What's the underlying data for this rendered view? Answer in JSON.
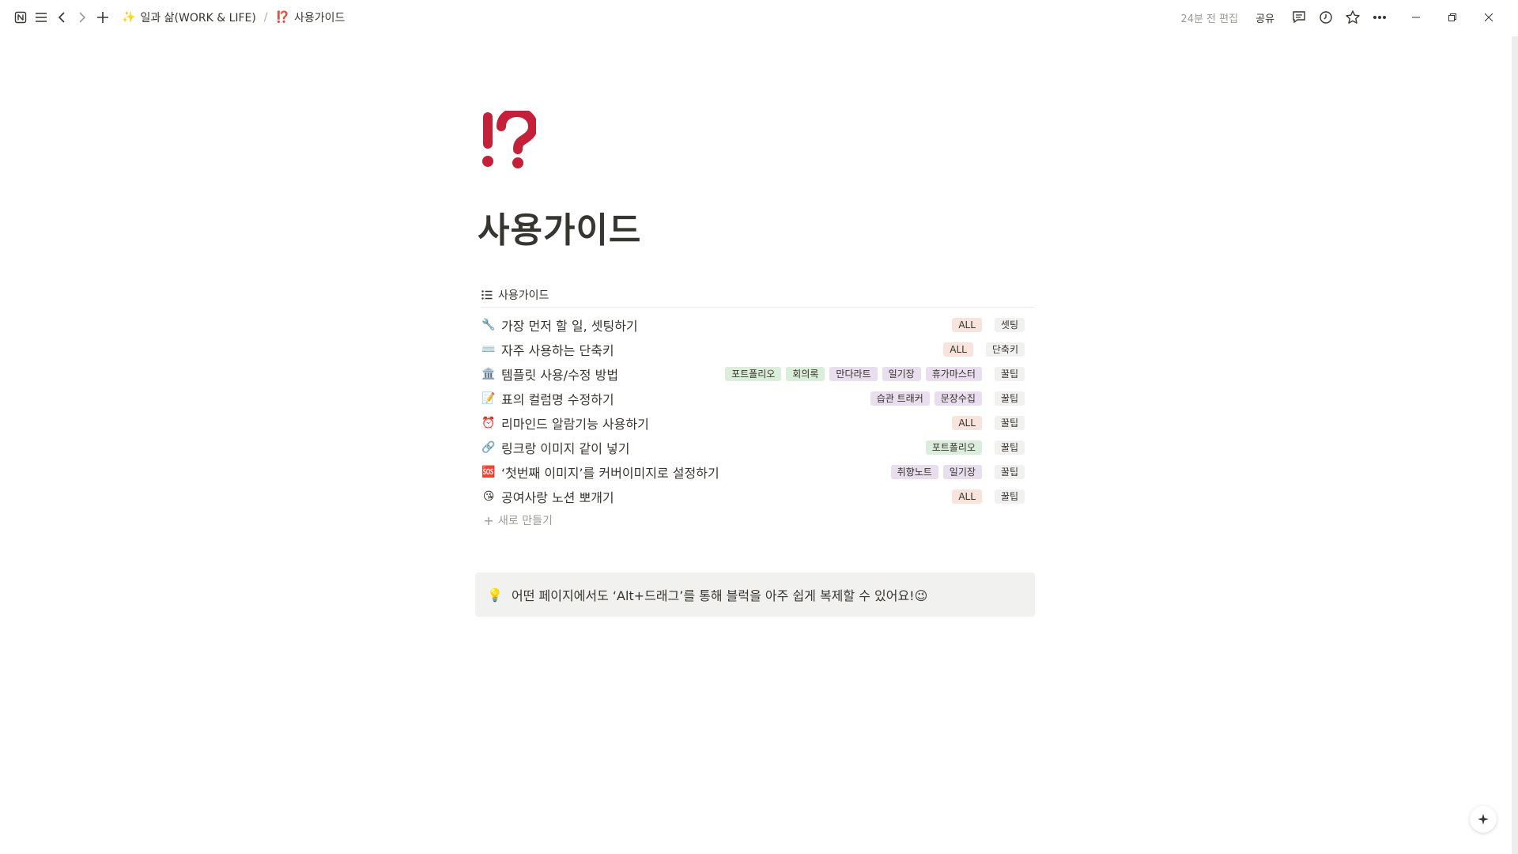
{
  "breadcrumb": {
    "parent_icon": "✨",
    "parent_label": "일과 삶(WORK & LIFE)",
    "separator": "/",
    "current_icon": "⁉️",
    "current_label": "사용가이드"
  },
  "header_right": {
    "edited": "24분 전 편집",
    "share": "공유"
  },
  "page": {
    "title": "사용가이드",
    "icon": "exclamation-question-mark-icon",
    "icon_color": "#c4203a"
  },
  "database": {
    "view_title": "사용가이드",
    "new_label": "새로 만들기",
    "rows": [
      {
        "emoji": "🔧",
        "title": "가장 먼저 할 일, 셋팅하기",
        "tags": [
          {
            "label": "ALL",
            "color": "#f8e4dd"
          }
        ],
        "category": "셋팅"
      },
      {
        "emoji": "⌨️",
        "title": "자주 사용하는 단축키",
        "tags": [
          {
            "label": "ALL",
            "color": "#f8e4dd"
          }
        ],
        "category": "단축키"
      },
      {
        "emoji": "🏛️",
        "title": "템플릿 사용/수정 방법",
        "tags": [
          {
            "label": "포트폴리오",
            "color": "#dbeddb"
          },
          {
            "label": "회의록",
            "color": "#dbeddb"
          },
          {
            "label": "만다라트",
            "color": "#e8deee"
          },
          {
            "label": "일기장",
            "color": "#e8deee"
          },
          {
            "label": "휴가마스터",
            "color": "#e8deee"
          }
        ],
        "category": "꿀팁"
      },
      {
        "emoji": "📝",
        "title": "표의 컬럼명 수정하기",
        "tags": [
          {
            "label": "습관 트래커",
            "color": "#e8deee"
          },
          {
            "label": "문장수집",
            "color": "#e8deee"
          }
        ],
        "category": "꿀팁"
      },
      {
        "emoji": "⏰",
        "title": "리마인드 알람기능 사용하기",
        "tags": [
          {
            "label": "ALL",
            "color": "#f8e4dd"
          }
        ],
        "category": "꿀팁"
      },
      {
        "emoji": "🔗",
        "title": "링크랑 이미지 같이 넣기",
        "tags": [
          {
            "label": "포트폴리오",
            "color": "#dbeddb"
          }
        ],
        "category": "꿀팁"
      },
      {
        "emoji": "🆘",
        "title": "‘첫번째 이미지’를 커버이미지로 설정하기",
        "tags": [
          {
            "label": "취향노트",
            "color": "#e8deee"
          },
          {
            "label": "일기장",
            "color": "#e8deee"
          }
        ],
        "category": "꿀팁"
      },
      {
        "emoji": "😘",
        "title": "공여사랑 노션 뽀개기",
        "tags": [
          {
            "label": "ALL",
            "color": "#f8e4dd"
          }
        ],
        "category": "꿀팁"
      }
    ],
    "category_color": "#f1f1ef"
  },
  "callout": {
    "icon": "💡",
    "text": "어떤 페이지에서도 ‘Alt+드래그’를 통해 블럭을 아주 쉽게 복제할 수 있어요!😉"
  }
}
